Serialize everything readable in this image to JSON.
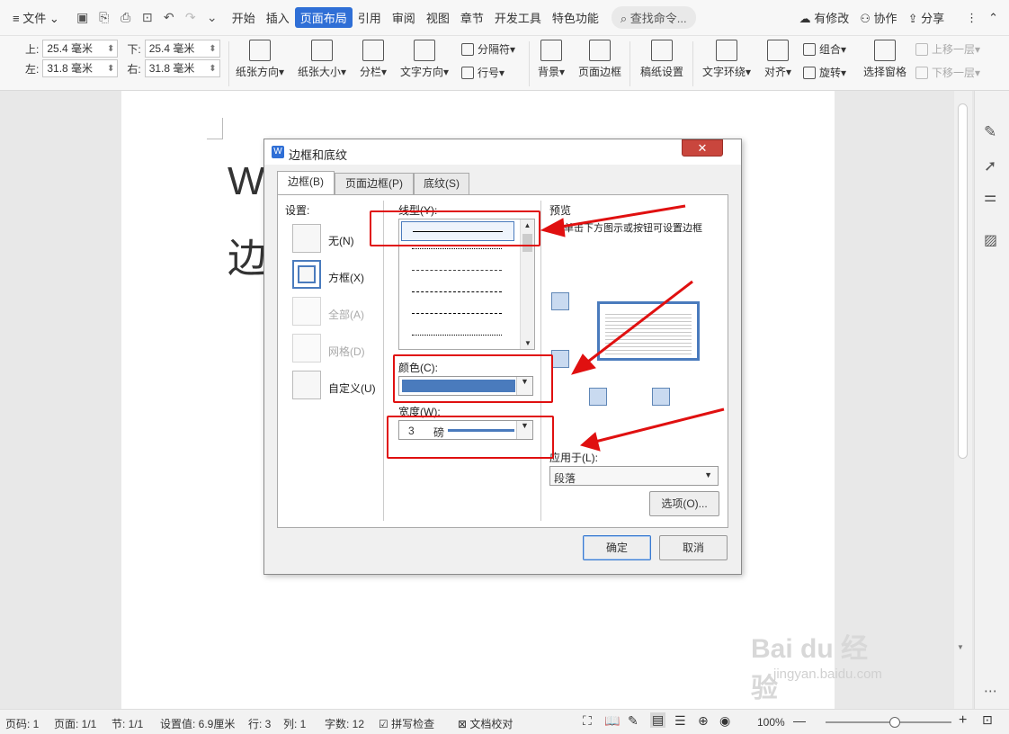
{
  "menubar": {
    "file_label": "文件",
    "tabs": [
      "开始",
      "插入",
      "页面布局",
      "引用",
      "审阅",
      "视图",
      "章节",
      "开发工具",
      "特色功能"
    ],
    "active_tab": "页面布局",
    "search_placeholder": "查找命令...",
    "right": [
      "有修改",
      "协作",
      "分享"
    ]
  },
  "ribbon": {
    "margins": {
      "top_label": "上:",
      "top_value": "25.4 毫米",
      "bottom_label": "下:",
      "bottom_value": "25.4 毫米",
      "left_label": "左:",
      "left_value": "31.8 毫米",
      "right_label": "右:",
      "right_value": "31.8 毫米"
    },
    "buttons": [
      "纸张方向",
      "纸张大小",
      "分栏",
      "文字方向",
      "背景",
      "页面边框",
      "稿纸设置",
      "文字环绕",
      "对齐",
      "选择窗格"
    ],
    "small": {
      "separator": "分隔符",
      "line_number": "行号",
      "group": "组合",
      "rotate": "旋转",
      "up_layer": "上移一层",
      "down_layer": "下移一层"
    }
  },
  "document": {
    "line1": "W",
    "line2": "边"
  },
  "dialog": {
    "title": "边框和底纹",
    "tabs": [
      "边框(B)",
      "页面边框(P)",
      "底纹(S)"
    ],
    "settings_label": "设置:",
    "settings": [
      "无(N)",
      "方框(X)",
      "全部(A)",
      "网格(D)",
      "自定义(U)"
    ],
    "line_style_label": "线型(Y):",
    "color_label": "颜色(C):",
    "color_value": "#4a7bbd",
    "width_label": "宽度(W):",
    "width_value": "3",
    "width_unit": "磅",
    "preview_label": "预览",
    "preview_hint": "单击下方图示或按钮可设置边框",
    "apply_label": "应用于(L):",
    "apply_value": "段落",
    "options_button": "选项(O)...",
    "ok_button": "确定",
    "cancel_button": "取消"
  },
  "statusbar": {
    "page_code": "页码: 1",
    "pages": "页面: 1/1",
    "section": "节: 1/1",
    "position": "设置值: 6.9厘米",
    "row": "行: 3",
    "col": "列: 1",
    "words": "字数: 12",
    "spell": "拼写检查",
    "proof": "文档校对",
    "zoom": "100%"
  },
  "watermark": {
    "brand": "Bai du 经验",
    "url": "jingyan.baidu.com"
  },
  "colors": {
    "accent": "#2f6fd6",
    "annotation_red": "#e01010",
    "border_blue": "#4a7bbd"
  }
}
